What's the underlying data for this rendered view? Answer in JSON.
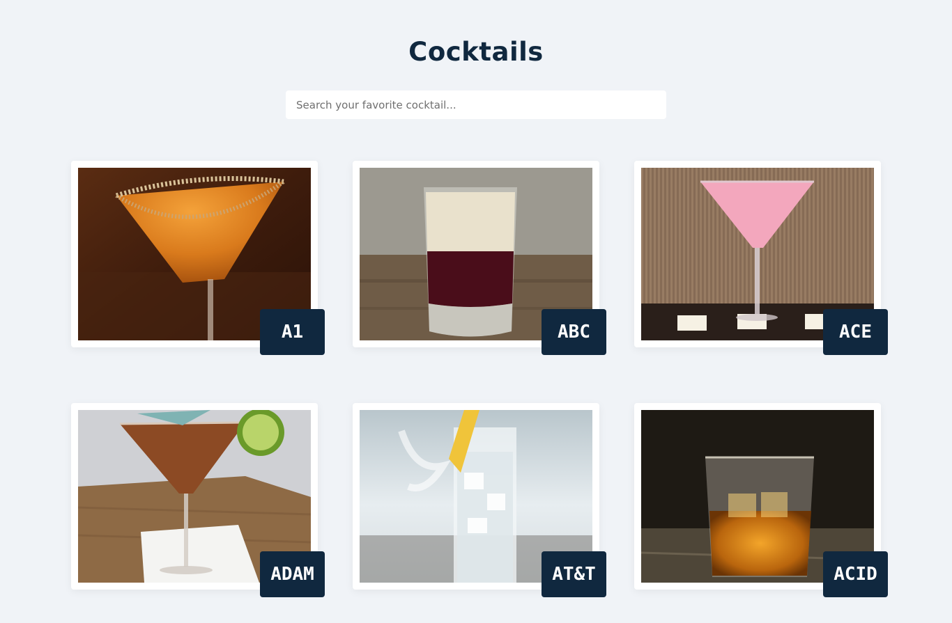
{
  "header": {
    "title": "Cocktails"
  },
  "search": {
    "placeholder": "Search your favorite cocktail..."
  },
  "cocktails": [
    {
      "name": "A1",
      "image": "orange-martini-sugar-rim-photo"
    },
    {
      "name": "ABC",
      "image": "layered-shot-glass-photo"
    },
    {
      "name": "ACE",
      "image": "pink-martini-candles-photo"
    },
    {
      "name": "ADAM",
      "image": "martini-lime-umbrella-photo"
    },
    {
      "name": "AT&T",
      "image": "highball-ice-lemon-photo"
    },
    {
      "name": "ACID",
      "image": "whiskey-rocks-glass-photo"
    }
  ],
  "colors": {
    "background": "#f0f3f7",
    "primary": "#10283f",
    "card": "#ffffff"
  }
}
